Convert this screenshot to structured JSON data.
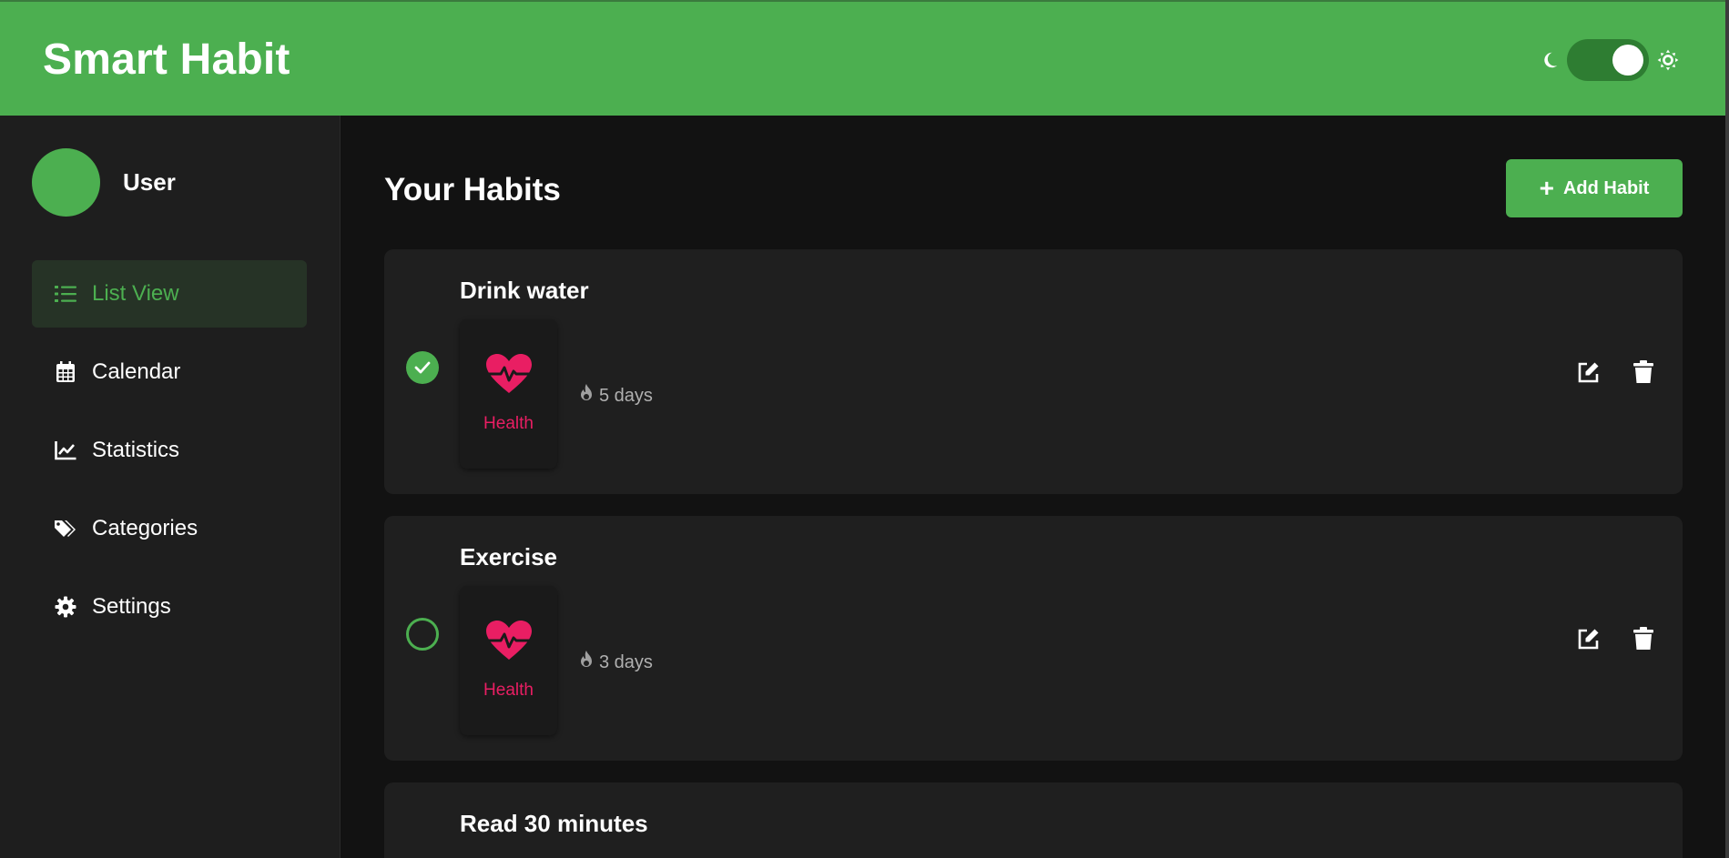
{
  "header": {
    "title": "Smart Habit",
    "brand_color": "#4caf50",
    "theme_toggle": {
      "state": "dark",
      "icons": [
        "moon-icon",
        "sun-icon"
      ]
    }
  },
  "sidebar": {
    "user": {
      "name": "User"
    },
    "items": [
      {
        "label": "List View",
        "icon": "list-icon",
        "active": true
      },
      {
        "label": "Calendar",
        "icon": "calendar-icon",
        "active": false
      },
      {
        "label": "Statistics",
        "icon": "chart-line-icon",
        "active": false
      },
      {
        "label": "Categories",
        "icon": "tags-icon",
        "active": false
      },
      {
        "label": "Settings",
        "icon": "gear-icon",
        "active": false
      }
    ]
  },
  "main": {
    "title": "Your Habits",
    "add_button": "Add Habit",
    "habits": [
      {
        "name": "Drink water",
        "category": "Health",
        "category_icon": "heartbeat-icon",
        "streak": "5 days",
        "completed": true
      },
      {
        "name": "Exercise",
        "category": "Health",
        "category_icon": "heartbeat-icon",
        "streak": "3 days",
        "completed": false
      },
      {
        "name": "Read 30 minutes"
      }
    ]
  },
  "colors": {
    "accent": "#4caf50",
    "category_health": "#e91e63",
    "background": "#121212",
    "card": "#1f1f1f",
    "sidebar": "#1e1e1e"
  }
}
